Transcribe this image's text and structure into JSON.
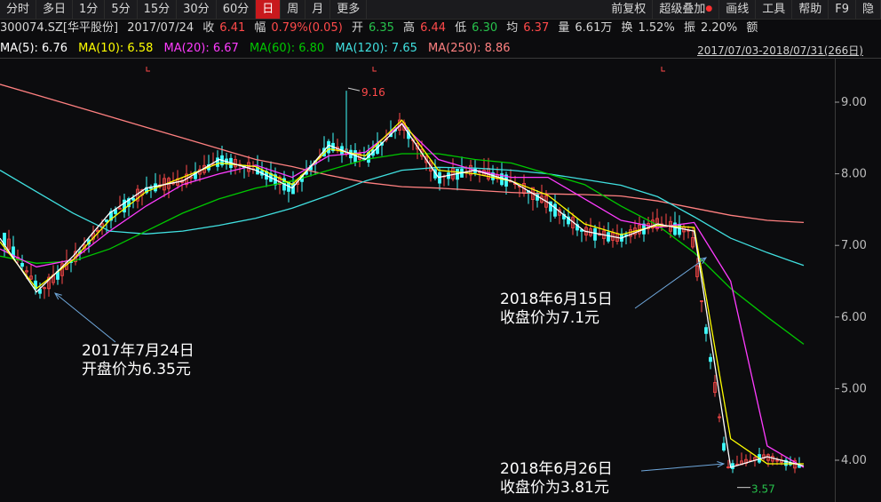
{
  "toolbar": {
    "left": [
      "分时",
      "多日",
      "1分",
      "5分",
      "15分",
      "30分",
      "60分",
      "日",
      "周",
      "月",
      "更多"
    ],
    "active": "日",
    "right": [
      "前复权",
      "超级叠加",
      "画线",
      "工具",
      "帮助",
      "F9",
      "隐"
    ]
  },
  "quote": {
    "code": "300074.SZ[华平股份]",
    "date": "2017/07/24",
    "close_label": "收",
    "close": "6.41",
    "change_label": "幅",
    "change": "0.79%(0.05)",
    "open_label": "开",
    "open": "6.35",
    "high_label": "高",
    "high": "6.44",
    "low_label": "低",
    "low": "6.30",
    "avg_label": "均",
    "avg": "6.37",
    "volume_label": "量",
    "volume": "6.61万",
    "turnover_label": "换",
    "turnover": "1.52%",
    "amplitude_label": "振",
    "amplitude": "2.20%",
    "amount_label": "额"
  },
  "ma": {
    "ma5": "MA(5): 6.76",
    "ma10": "MA(10): 6.58",
    "ma20": "MA(20): 6.67",
    "ma60": "MA(60): 6.80",
    "ma120": "MA(120): 7.65",
    "ma250": "MA(250): 8.86"
  },
  "date_range": "2017/07/03-2018/07/31(266日)",
  "colors": {
    "ma5": "#ffffff",
    "ma10": "#ffff00",
    "ma20": "#ff3cff",
    "ma60": "#00c800",
    "ma120": "#40e0e0",
    "ma250": "#ff8080",
    "up": "#ff4a4a",
    "down": "#40ffff",
    "axis": "#a0a0a0"
  },
  "chart_data": {
    "type": "line",
    "yticks": [
      "9.00",
      "8.00",
      "7.00",
      "6.00",
      "5.00",
      "4.00"
    ],
    "ylim": [
      3.45,
      9.45
    ],
    "max_label": "9.16",
    "min_label": "3.57",
    "series": [
      {
        "name": "MA250",
        "values": [
          9.25,
          9.1,
          8.95,
          8.8,
          8.65,
          8.5,
          8.35,
          8.2,
          8.1,
          7.98,
          7.88,
          7.82,
          7.8,
          7.77,
          7.74,
          7.72,
          7.71,
          7.69,
          7.62,
          7.52,
          7.42,
          7.35,
          7.32
        ]
      },
      {
        "name": "MA120",
        "values": [
          8.05,
          7.75,
          7.45,
          7.2,
          7.16,
          7.2,
          7.28,
          7.38,
          7.52,
          7.7,
          7.9,
          8.05,
          8.09,
          8.08,
          8.05,
          8.0,
          7.92,
          7.84,
          7.68,
          7.4,
          7.1,
          6.9,
          6.72
        ]
      },
      {
        "name": "MA60",
        "values": [
          6.85,
          6.75,
          6.78,
          6.95,
          7.2,
          7.45,
          7.65,
          7.8,
          7.9,
          8.05,
          8.2,
          8.28,
          8.28,
          8.2,
          8.15,
          8.0,
          7.85,
          7.55,
          7.28,
          6.9,
          6.4,
          6.0,
          5.62
        ]
      },
      {
        "name": "MA20",
        "values": [
          6.95,
          6.7,
          6.8,
          7.2,
          7.55,
          7.85,
          8.0,
          8.12,
          7.95,
          8.25,
          8.3,
          8.7,
          8.2,
          8.05,
          7.95,
          7.95,
          7.65,
          7.35,
          7.25,
          7.32,
          6.5,
          4.2,
          3.9
        ]
      },
      {
        "name": "MA10",
        "values": [
          7.05,
          6.4,
          6.8,
          7.35,
          7.75,
          7.95,
          8.15,
          8.1,
          7.85,
          8.35,
          8.25,
          8.75,
          8.05,
          8.0,
          7.9,
          7.7,
          7.3,
          7.15,
          7.28,
          7.25,
          4.3,
          3.95,
          3.95
        ]
      },
      {
        "name": "MA5",
        "values": [
          7.1,
          6.35,
          6.85,
          7.45,
          7.8,
          7.9,
          8.2,
          8.05,
          7.8,
          8.4,
          8.2,
          8.7,
          7.95,
          8.05,
          7.9,
          7.6,
          7.2,
          7.1,
          7.3,
          7.2,
          3.9,
          4.05,
          3.92
        ]
      }
    ]
  },
  "annotations": [
    {
      "line1": "2017年7月24日",
      "line2": "开盘价为6.35元"
    },
    {
      "line1": "2018年6月15日",
      "line2": "收盘价为7.1元"
    },
    {
      "line1": "2018年6月26日",
      "line2": "收盘价为3.81元"
    }
  ]
}
